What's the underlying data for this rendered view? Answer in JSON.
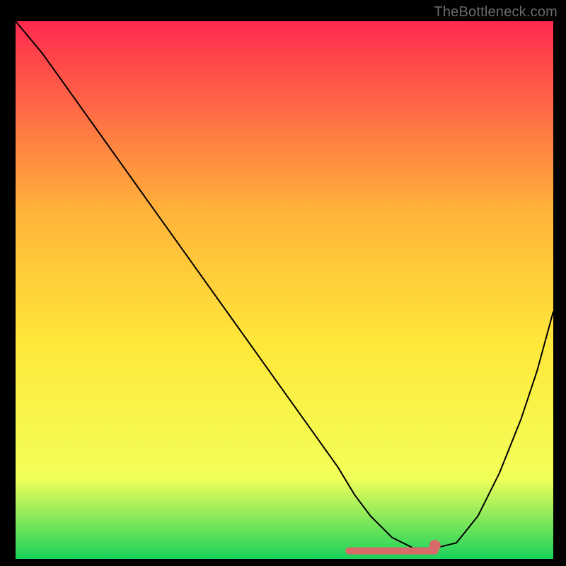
{
  "watermark": "TheBottleneck.com",
  "chart_data": {
    "type": "line",
    "title": "",
    "xlabel": "",
    "ylabel": "",
    "xlim": [
      0,
      100
    ],
    "ylim": [
      0,
      100
    ],
    "grid": false,
    "legend": false,
    "background_gradient": {
      "top": "#ff2a4f",
      "mid_upper": "#ffb23a",
      "mid": "#ffe83a",
      "mid_lower": "#f2ff59",
      "bottom": "#19d25b"
    },
    "series": [
      {
        "name": "curve",
        "color": "#000000",
        "stroke_width": 2,
        "x": [
          0,
          5,
          10,
          15,
          20,
          25,
          30,
          35,
          40,
          45,
          50,
          55,
          60,
          63,
          66,
          70,
          74,
          78,
          82,
          86,
          90,
          94,
          97,
          100
        ],
        "y": [
          100,
          94,
          87,
          80,
          73,
          66,
          59,
          52,
          45,
          38,
          31,
          24,
          17,
          12,
          8,
          4,
          2,
          2,
          3,
          8,
          16,
          26,
          35,
          46
        ]
      }
    ],
    "highlight": {
      "color": "#d86a6a",
      "x_range": [
        62,
        78
      ],
      "y": 1.5,
      "cap_x": 78
    }
  }
}
